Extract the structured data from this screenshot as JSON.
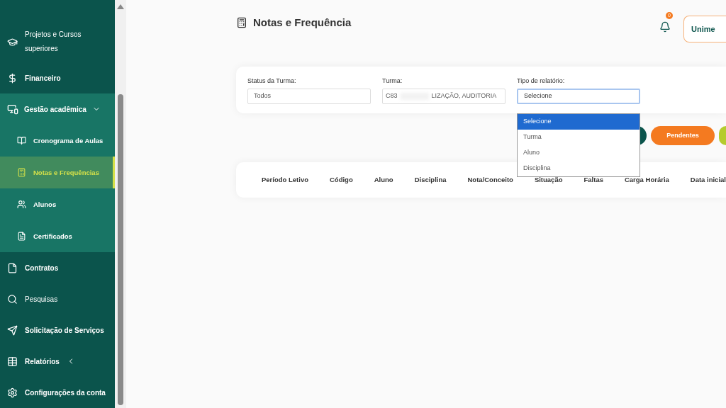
{
  "sidebar": {
    "items": [
      {
        "label": "Projetos e Cursos superiores"
      },
      {
        "label": "Financeiro"
      },
      {
        "label": "Gestão acadêmica",
        "expanded": true,
        "children": [
          {
            "label": "Cronograma de Aulas",
            "selected": false
          },
          {
            "label": "Notas e Frequências",
            "selected": true
          },
          {
            "label": "Alunos",
            "selected": false
          },
          {
            "label": "Certificados",
            "selected": false
          }
        ]
      },
      {
        "label": "Contratos"
      },
      {
        "label": "Pesquisas"
      },
      {
        "label": "Solicitação de Serviços"
      },
      {
        "label": "Relatórios",
        "expanded": false
      },
      {
        "label": "Configurações da conta"
      }
    ]
  },
  "header": {
    "title": "Notas e Frequência",
    "notifications": "0",
    "account": "Unime"
  },
  "filters": [
    {
      "label": "Status da Turma:",
      "value": "Todos",
      "kind": "field"
    },
    {
      "label": "Turma:",
      "value": "C83",
      "value_end": "LIZAÇÃO, AUDITORIA",
      "kind": "blurred"
    },
    {
      "label": "Tipo de relatório:",
      "value": "Selecione",
      "kind": "select",
      "options": [
        {
          "label": "Selecione",
          "selected": true
        },
        {
          "label": "Turma",
          "selected": false
        },
        {
          "label": "Aluno",
          "selected": false
        },
        {
          "label": "Disciplina",
          "selected": false
        }
      ]
    }
  ],
  "actions": [
    {
      "color": "#0b544c"
    },
    {
      "label": "Pendentes",
      "color": "#f47a20"
    },
    {
      "color": "#b5cc2e"
    }
  ],
  "table": {
    "columns": [
      "Período Letivo",
      "Código",
      "Aluno",
      "Disciplina",
      "Nota/Conceito",
      "Situação",
      "Faltas",
      "Carga Horária",
      "Data inicial"
    ]
  }
}
